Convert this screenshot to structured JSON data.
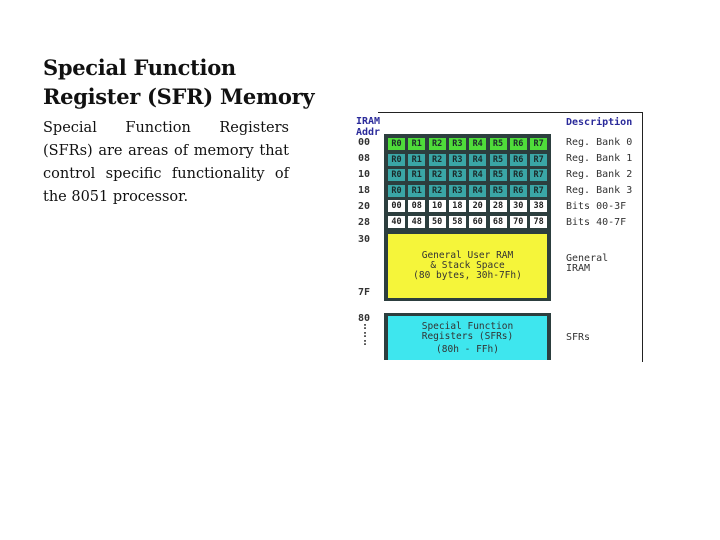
{
  "slide": {
    "title": "Special Function Register (SFR) Memory",
    "body": "Special Function Registers (SFRs) are areas of memory that control specific functionality of the 8051 processor."
  },
  "diagram": {
    "header_addr_line1": "IRAM",
    "header_addr_line2": "Addr",
    "header_desc": "Description",
    "addresses": [
      "00",
      "08",
      "10",
      "18",
      "20",
      "28",
      "30",
      "7F",
      "80"
    ],
    "rows": [
      {
        "cells": [
          "R0",
          "R1",
          "R2",
          "R3",
          "R4",
          "R5",
          "R6",
          "R7"
        ],
        "style": "green",
        "desc": "Reg. Bank 0"
      },
      {
        "cells": [
          "R0",
          "R1",
          "R2",
          "R3",
          "R4",
          "R5",
          "R6",
          "R7"
        ],
        "style": "teal",
        "desc": "Reg. Bank 1"
      },
      {
        "cells": [
          "R0",
          "R1",
          "R2",
          "R3",
          "R4",
          "R5",
          "R6",
          "R7"
        ],
        "style": "teal",
        "desc": "Reg. Bank 2"
      },
      {
        "cells": [
          "R0",
          "R1",
          "R2",
          "R3",
          "R4",
          "R5",
          "R6",
          "R7"
        ],
        "style": "teal",
        "desc": "Reg. Bank 3"
      },
      {
        "cells": [
          "00",
          "08",
          "10",
          "18",
          "20",
          "28",
          "30",
          "38"
        ],
        "style": "white",
        "desc": "Bits 00-3F"
      },
      {
        "cells": [
          "40",
          "48",
          "50",
          "58",
          "60",
          "68",
          "70",
          "78"
        ],
        "style": "white",
        "desc": "Bits 40-7F"
      }
    ],
    "general_ram": {
      "line1": "General User RAM",
      "line2": "& Stack Space",
      "line3": "(80 bytes, 30h-7Fh)",
      "desc_line1": "General",
      "desc_line2": "IRAM"
    },
    "sfr_block": {
      "line1": "Special Function",
      "line2": "Registers (SFRs)",
      "line3": "(80h - FFh)",
      "desc": "SFRs"
    },
    "colors": {
      "bank0": "#4fdc3a",
      "banks": "#3aa6a6",
      "bit_cells": "#ffffff",
      "general_ram": "#f5f53a",
      "sfr": "#3ee6ee",
      "grid_bg": "#2c3e3e",
      "header_text": "#2a2a9a"
    }
  }
}
